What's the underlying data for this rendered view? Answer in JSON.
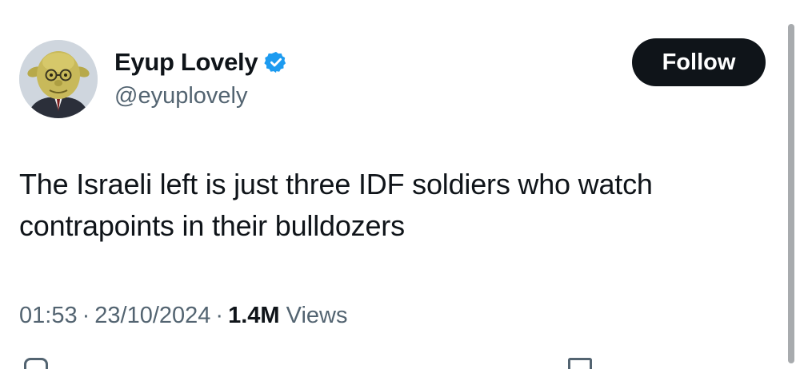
{
  "author": {
    "display_name": "Eyup Lovely",
    "handle": "@eyuplovely",
    "avatar_icon": "avatar-portrait-icon",
    "verified_icon": "verified-badge-icon",
    "verified_color": "#1d9bf0"
  },
  "follow_button": {
    "label": "Follow",
    "bg_color": "#0f1419",
    "text_color": "#ffffff"
  },
  "tweet": {
    "text": "The Israeli left is just three IDF soldiers who watch contrapoints in their bulldozers",
    "time": "01:53",
    "date": "23/10/2024",
    "separator": "·",
    "views_count": "1.4M",
    "views_label": "Views"
  },
  "colors": {
    "text_primary": "#0f1419",
    "text_secondary": "#536471"
  }
}
